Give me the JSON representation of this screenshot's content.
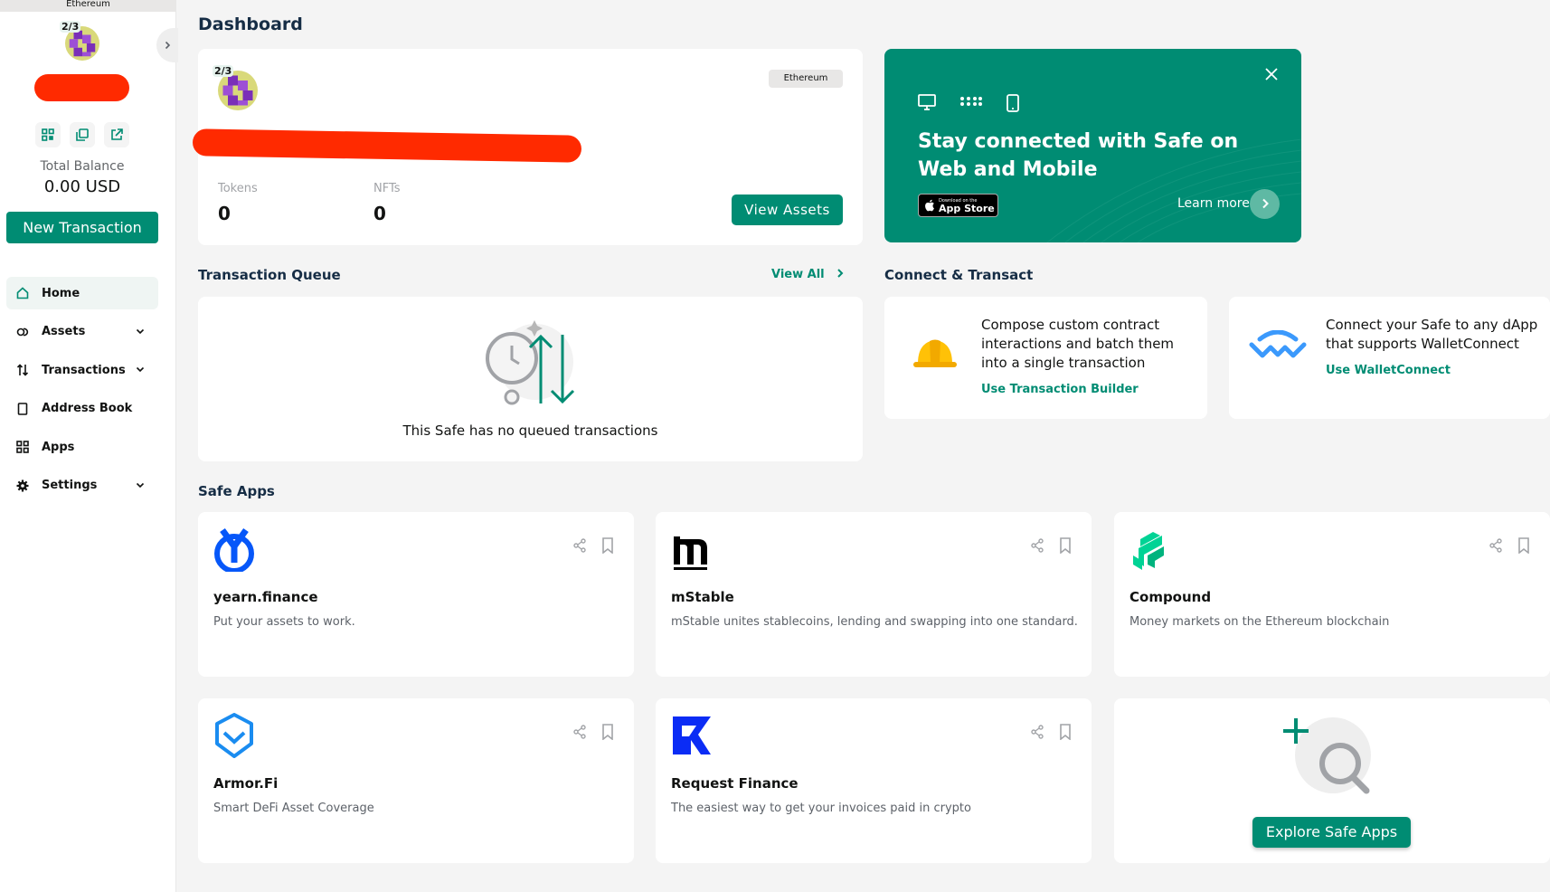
{
  "network": "Ethereum",
  "sidebar": {
    "threshold": "2/3",
    "total_balance_label": "Total Balance",
    "total_balance_value": "0.00 USD",
    "new_transaction_label": "New Transaction",
    "nav": [
      {
        "label": "Home",
        "icon": "home-icon",
        "active": true
      },
      {
        "label": "Assets",
        "icon": "assets-icon"
      },
      {
        "label": "Transactions",
        "icon": "transactions-icon"
      },
      {
        "label": "Address Book",
        "icon": "address-book-icon"
      },
      {
        "label": "Apps",
        "icon": "apps-icon"
      },
      {
        "label": "Settings",
        "icon": "gear-icon"
      }
    ]
  },
  "main": {
    "title": "Dashboard",
    "overview": {
      "threshold": "2/3",
      "network_chip": "Ethereum",
      "tokens_label": "Tokens",
      "tokens_value": "0",
      "nfts_label": "NFTs",
      "nfts_value": "0",
      "view_assets_label": "View Assets"
    },
    "banner": {
      "title": "Stay connected with Safe on Web and Mobile",
      "appstore_small": "Download on the",
      "appstore_big": "App Store",
      "learn_more": "Learn more"
    },
    "queue": {
      "title": "Transaction Queue",
      "view_all": "View All",
      "empty_text": "This Safe has no queued transactions"
    },
    "connect": {
      "title": "Connect & Transact",
      "builder_text": "Compose custom contract interactions and batch them into a single transaction",
      "builder_link": "Use Transaction Builder",
      "wc_text": "Connect your Safe to any dApp that supports WalletConnect",
      "wc_link": "Use WalletConnect"
    },
    "safe_apps": {
      "title": "Safe Apps",
      "apps": [
        {
          "name": "yearn.finance",
          "description": "Put your assets to work."
        },
        {
          "name": "mStable",
          "description": "mStable unites stablecoins, lending and swapping into one standard."
        },
        {
          "name": "Compound",
          "description": "Money markets on the Ethereum blockchain"
        },
        {
          "name": "Armor.Fi",
          "description": "Smart DeFi Asset Coverage"
        },
        {
          "name": "Request Finance",
          "description": "The easiest way to get your invoices paid in crypto"
        }
      ],
      "explore_label": "Explore Safe Apps"
    }
  },
  "colors": {
    "primary": "#008c73",
    "active_nav_bg": "#eff5f3",
    "title": "#162d45"
  }
}
